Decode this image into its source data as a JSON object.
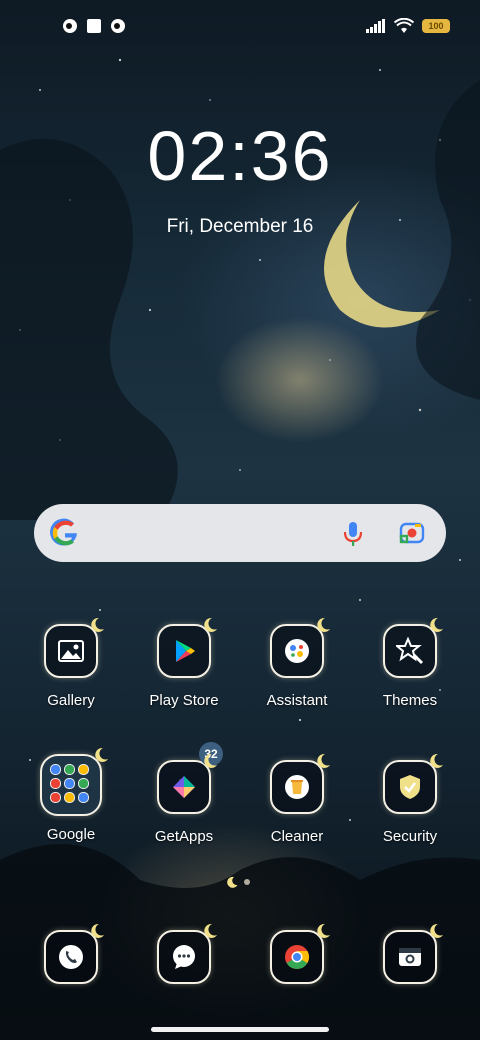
{
  "status_bar": {
    "left_icons": [
      "notification-icon",
      "square-notification-icon",
      "notification-icon"
    ],
    "right_icons": [
      "signal-icon",
      "wifi-icon",
      "battery-icon"
    ],
    "battery_text": "100"
  },
  "lockscreen": {
    "time": "02:36",
    "date": "Fri, December 16"
  },
  "search_bar": {
    "icons": [
      "google-g-icon",
      "microphone-icon",
      "lens-camera-icon"
    ]
  },
  "apps_row1": [
    {
      "label": "Gallery",
      "icon": "gallery-icon"
    },
    {
      "label": "Play Store",
      "icon": "play-store-icon"
    },
    {
      "label": "Assistant",
      "icon": "assistant-icon"
    },
    {
      "label": "Themes",
      "icon": "themes-icon"
    }
  ],
  "apps_row2": [
    {
      "label": "Google",
      "icon": "folder-icon"
    },
    {
      "label": "GetApps",
      "icon": "getapps-icon",
      "badge": "32"
    },
    {
      "label": "Cleaner",
      "icon": "cleaner-icon"
    },
    {
      "label": "Security",
      "icon": "security-icon"
    }
  ],
  "dock": [
    {
      "icon": "phone-icon"
    },
    {
      "icon": "messages-icon"
    },
    {
      "icon": "chrome-icon"
    },
    {
      "icon": "camera-icon"
    }
  ],
  "colors": {
    "accent_moon": "#f1e08a",
    "battery": "#e6b740",
    "badge": "#3d5f80"
  }
}
